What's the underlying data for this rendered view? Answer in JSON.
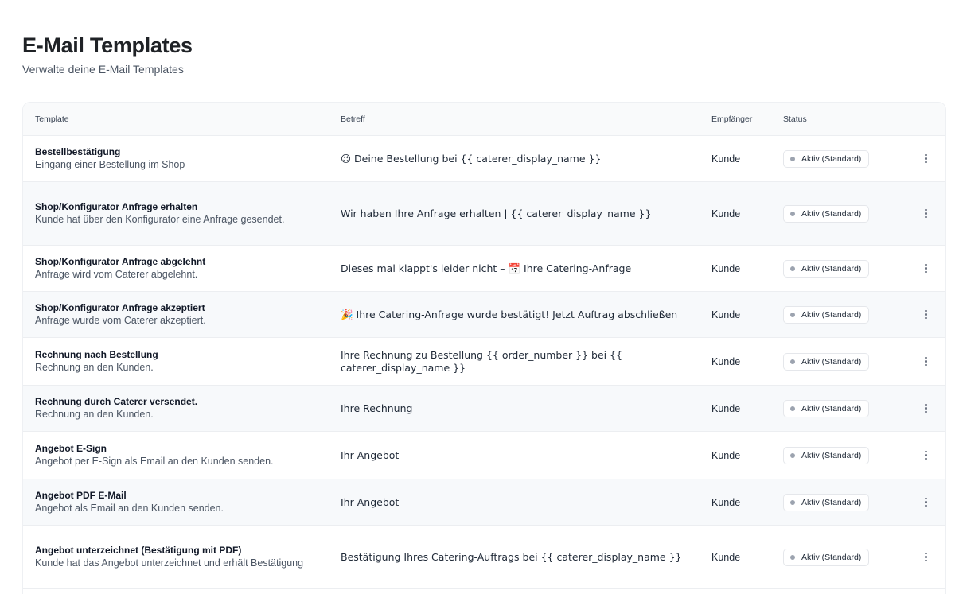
{
  "page": {
    "title": "E-Mail Templates",
    "subtitle": "Verwalte deine E-Mail Templates"
  },
  "table": {
    "headers": {
      "template": "Template",
      "subject": "Betreff",
      "recipient": "Empfänger",
      "status": "Status"
    },
    "rows": [
      {
        "name": "Bestellbestätigung",
        "description": "Eingang einer Bestellung im Shop",
        "subject": "😉 Deine Bestellung bei {{ caterer_display_name }}",
        "recipient": "Kunde",
        "status": "Aktiv (Standard)"
      },
      {
        "name": "Shop/Konfigurator Anfrage erhalten",
        "description": "Kunde hat über den Konfigurator eine Anfrage gesendet.",
        "subject": "Wir haben Ihre Anfrage erhalten | {{ caterer_display_name }}",
        "recipient": "Kunde",
        "status": "Aktiv (Standard)"
      },
      {
        "name": "Shop/Konfigurator Anfrage abgelehnt",
        "description": "Anfrage wird vom Caterer abgelehnt.",
        "subject": "Dieses mal klappt's leider nicht – 📅 Ihre Catering-Anfrage",
        "recipient": "Kunde",
        "status": "Aktiv (Standard)"
      },
      {
        "name": "Shop/Konfigurator Anfrage akzeptiert",
        "description": "Anfrage wurde vom Caterer akzeptiert.",
        "subject": "🎉 Ihre Catering-Anfrage wurde bestätigt! Jetzt Auftrag abschließen",
        "recipient": "Kunde",
        "status": "Aktiv (Standard)"
      },
      {
        "name": "Rechnung nach Bestellung",
        "description": "Rechnung an den Kunden.",
        "subject": "Ihre Rechnung zu Bestellung {{ order_number }} bei {{ caterer_display_name }}",
        "recipient": "Kunde",
        "status": "Aktiv (Standard)"
      },
      {
        "name": "Rechnung durch Caterer versendet.",
        "description": "Rechnung an den Kunden.",
        "subject": "Ihre Rechnung",
        "recipient": "Kunde",
        "status": "Aktiv (Standard)"
      },
      {
        "name": "Angebot E-Sign",
        "description": "Angebot per E-Sign als Email an den Kunden senden.",
        "subject": "Ihr Angebot",
        "recipient": "Kunde",
        "status": "Aktiv (Standard)"
      },
      {
        "name": "Angebot PDF E-Mail",
        "description": "Angebot als Email an den Kunden senden.",
        "subject": "Ihr Angebot",
        "recipient": "Kunde",
        "status": "Aktiv (Standard)"
      },
      {
        "name": "Angebot unterzeichnet (Bestätigung mit PDF)",
        "description": "Kunde hat das Angebot unterzeichnet und erhält Bestätigung",
        "subject": "Bestätigung Ihres Catering-Auftrags bei {{ caterer_display_name }}",
        "recipient": "Kunde",
        "status": "Aktiv (Standard)"
      }
    ]
  },
  "icons": {
    "actions": "more-vertical-icon",
    "status_dot": "status-dot-icon"
  }
}
